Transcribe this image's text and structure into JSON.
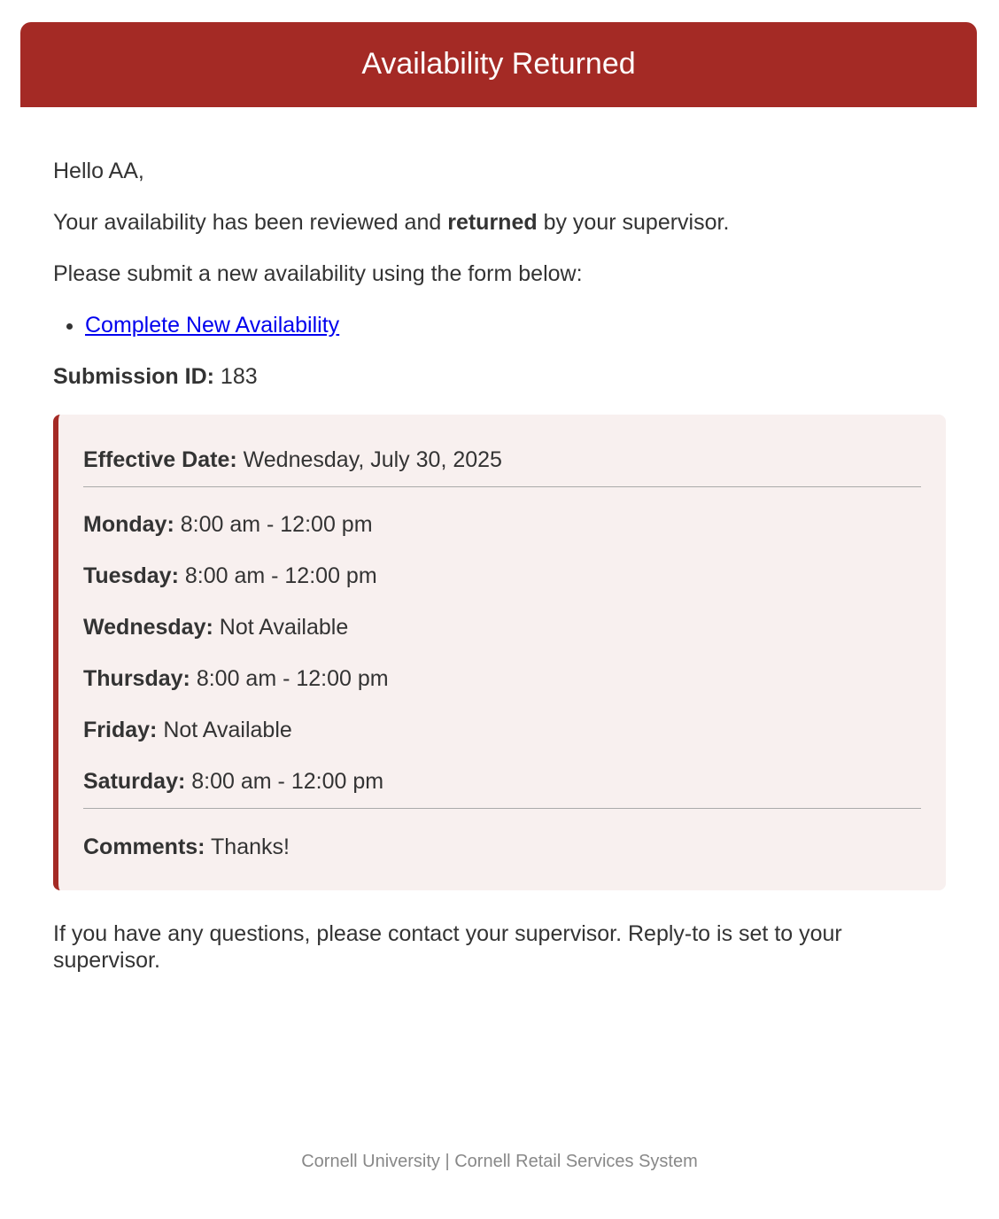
{
  "header": {
    "title": "Availability Returned",
    "background_color": "#a42a25"
  },
  "greeting": "Hello AA,",
  "message": {
    "prefix": "Your availability has been reviewed and",
    "emphasis": "returned",
    "suffix": "by your supervisor."
  },
  "instruction": "Please submit a new availability using the form below:",
  "link": {
    "label": "Complete New Availability"
  },
  "submission": {
    "label": "Submission ID:",
    "value": "183"
  },
  "details": {
    "effective_date_label": "Effective Date:",
    "effective_date_value": "Wednesday, July 30, 2025",
    "schedule": [
      {
        "day": "Monday:",
        "hours": "8:00 am - 12:00 pm"
      },
      {
        "day": "Tuesday:",
        "hours": "8:00 am - 12:00 pm"
      },
      {
        "day": "Wednesday:",
        "hours": "Not Available"
      },
      {
        "day": "Thursday:",
        "hours": "8:00 am - 12:00 pm"
      },
      {
        "day": "Friday:",
        "hours": "Not Available"
      },
      {
        "day": "Saturday:",
        "hours": "8:00 am - 12:00 pm"
      }
    ],
    "comments_label": "Comments:",
    "comments_value": "Thanks!",
    "background_color": "#f8f0ef",
    "accent_color": "#a42a25"
  },
  "closing": "If you have any questions, please contact your supervisor. Reply-to is set to your supervisor.",
  "footer": "Cornell University | Cornell Retail Services System"
}
